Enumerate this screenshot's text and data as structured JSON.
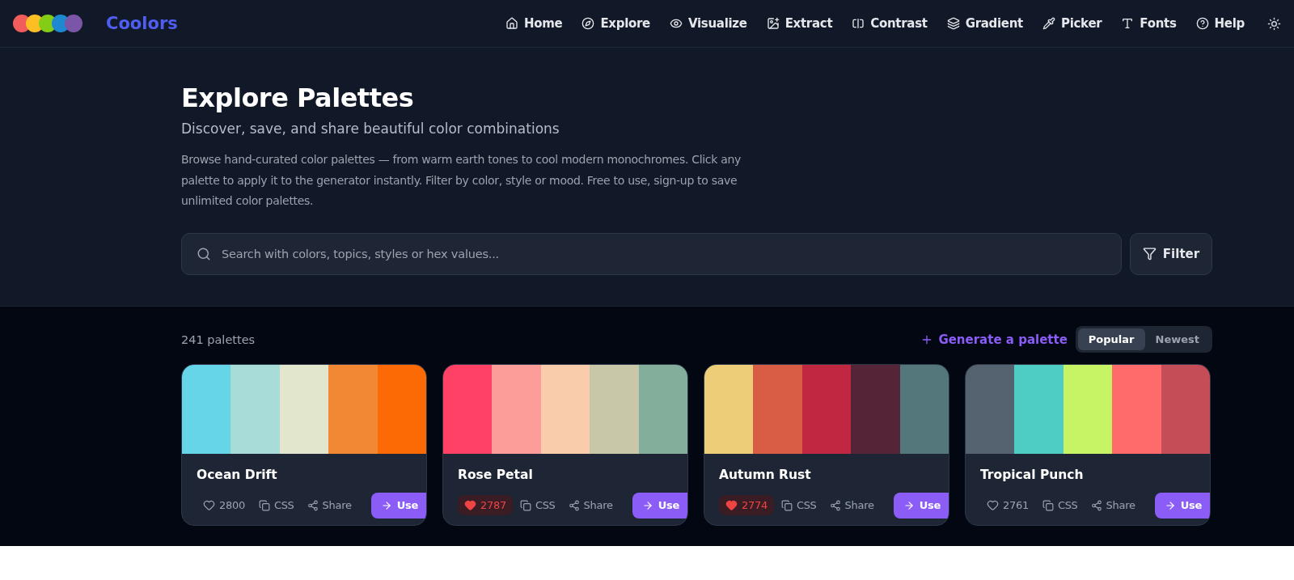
{
  "brand": {
    "name": "Coolors",
    "logo_dots": [
      {
        "color": "#f25c5c"
      },
      {
        "color": "#fbbf24"
      },
      {
        "color": "#84cc16"
      },
      {
        "color": "#1e88d0"
      },
      {
        "color": "#7b56a8"
      }
    ]
  },
  "nav": [
    {
      "label": "Home"
    },
    {
      "label": "Explore"
    },
    {
      "label": "Visualize"
    },
    {
      "label": "Extract"
    },
    {
      "label": "Contrast"
    },
    {
      "label": "Gradient"
    },
    {
      "label": "Picker"
    },
    {
      "label": "Fonts"
    },
    {
      "label": "Help"
    }
  ],
  "header": {
    "title": "Explore Palettes",
    "subtitle": "Discover, save, and share beautiful color combinations",
    "description": "Browse hand-curated color palettes — from warm earth tones to cool modern monochromes. Click any palette to apply it to the generator instantly. Filter by color, style or mood. Free to use, sign-up to save unlimited color palettes.",
    "search": {
      "placeholder": "Search with colors, topics, styles or hex values..."
    },
    "filter_button": "Filter"
  },
  "toolbar": {
    "count": "241 palettes",
    "generate_link": "Generate a palette",
    "sort_tabs": [
      {
        "label": "Popular",
        "selected": true
      },
      {
        "label": "Newest",
        "selected": false
      }
    ]
  },
  "palettes": [
    {
      "name": "Ocean Drift",
      "likes": "2800",
      "liked": false,
      "css": "CSS",
      "share": "Share",
      "use": "Use",
      "swatches": [
        {
          "color": "#67d5e8"
        },
        {
          "color": "#a8dcd8"
        },
        {
          "color": "#e1e6cd"
        },
        {
          "color": "#f28834"
        },
        {
          "color": "#fb6a04"
        }
      ]
    },
    {
      "name": "Rose Petal",
      "likes": "2787",
      "liked": true,
      "css": "CSS",
      "share": "Share",
      "use": "Use",
      "swatches": [
        {
          "color": "#fe4164"
        },
        {
          "color": "#fc9d99"
        },
        {
          "color": "#f9cdac"
        },
        {
          "color": "#c8c8a9"
        },
        {
          "color": "#83ae9b"
        }
      ]
    },
    {
      "name": "Autumn Rust",
      "likes": "2774",
      "liked": true,
      "css": "CSS",
      "share": "Share",
      "use": "Use",
      "swatches": [
        {
          "color": "#edcd78"
        },
        {
          "color": "#d95d45"
        },
        {
          "color": "#c12741"
        },
        {
          "color": "#542437"
        },
        {
          "color": "#53777a"
        }
      ]
    },
    {
      "name": "Tropical Punch",
      "likes": "2761",
      "liked": false,
      "css": "CSS",
      "share": "Share",
      "use": "Use",
      "swatches": [
        {
          "color": "#556270"
        },
        {
          "color": "#4ecdc4"
        },
        {
          "color": "#c7f464"
        },
        {
          "color": "#ff6b6b"
        },
        {
          "color": "#c44d58"
        }
      ]
    }
  ]
}
